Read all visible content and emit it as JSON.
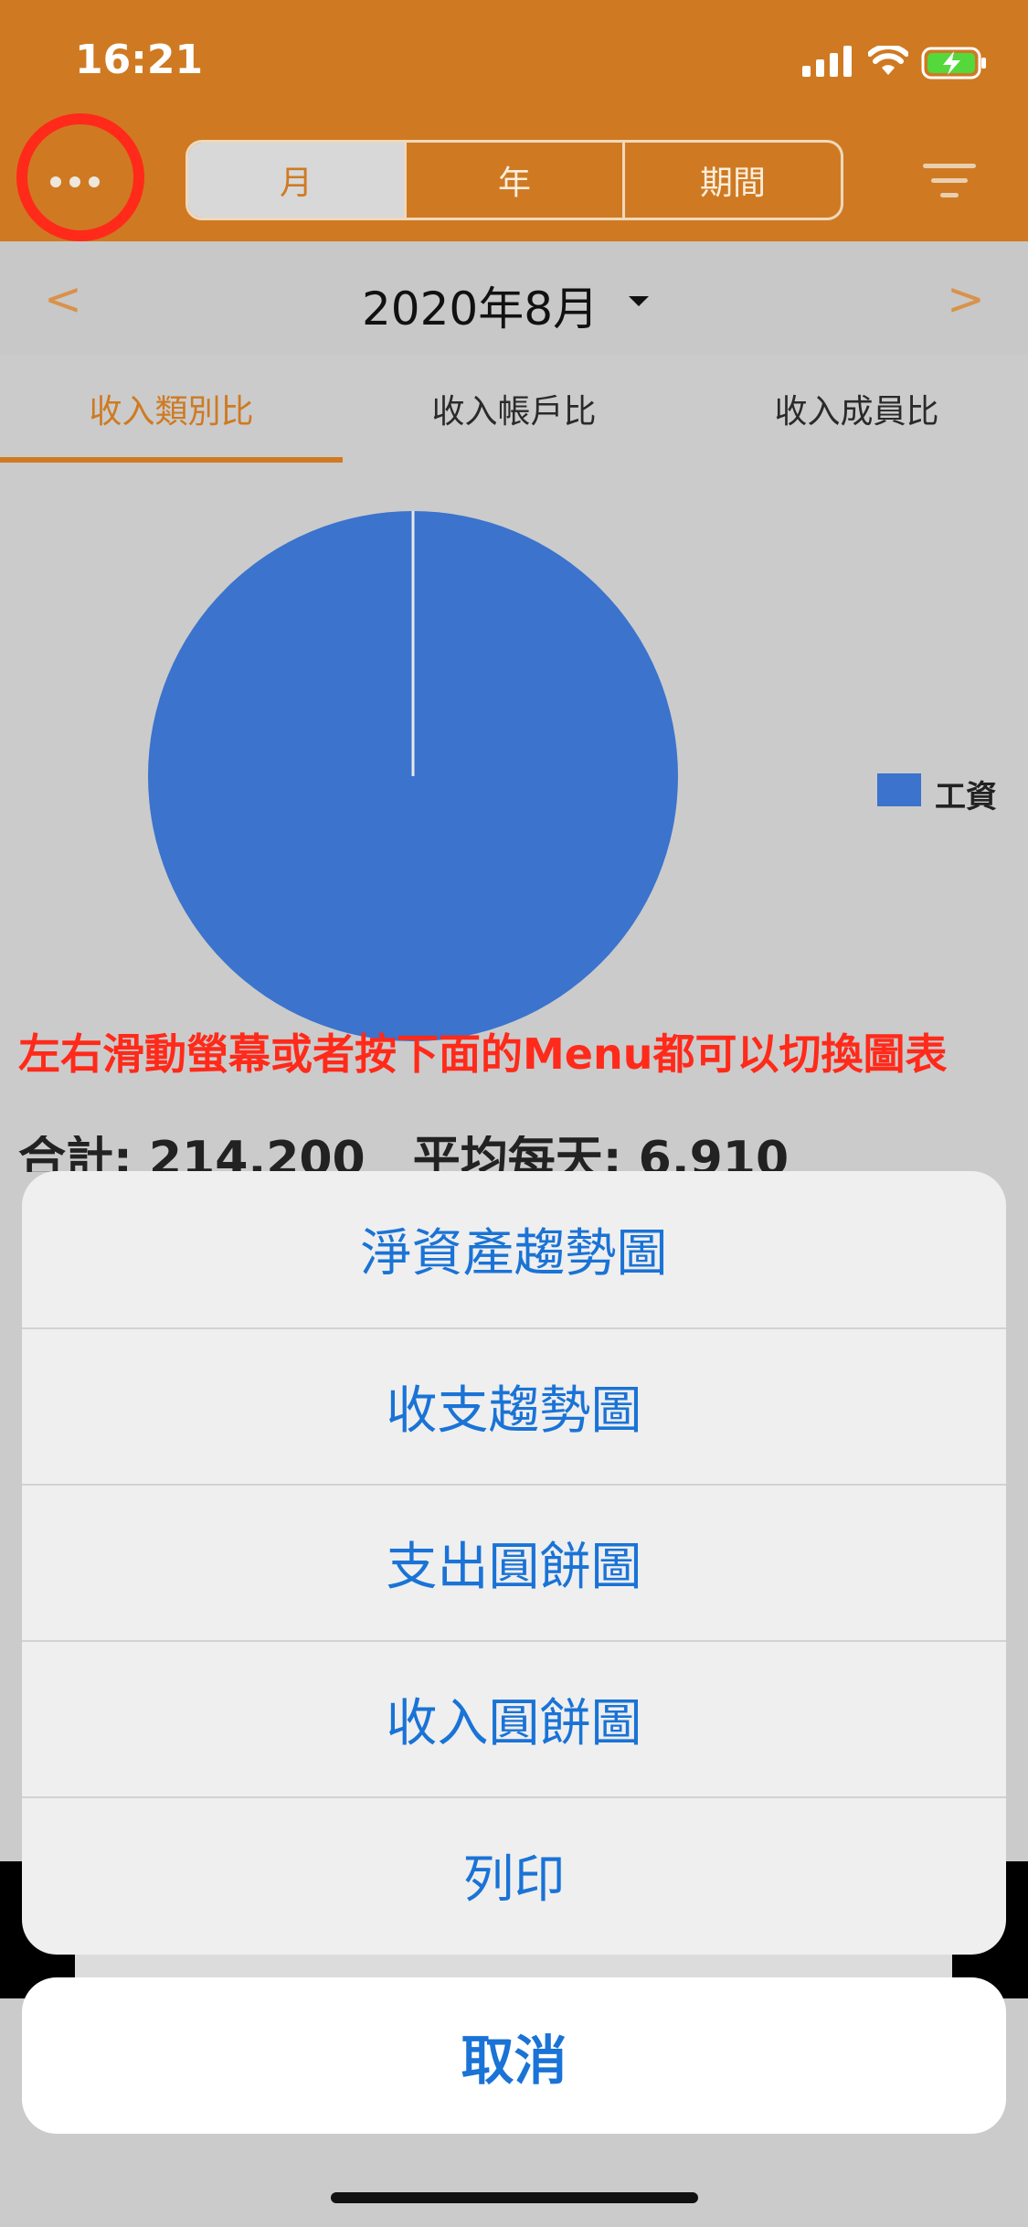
{
  "status_bar": {
    "time": "16:21",
    "icons": [
      "signal-icon",
      "wifi-icon",
      "battery-charging-icon"
    ]
  },
  "nav": {
    "more_icon": "ellipsis-icon",
    "segments": [
      "月",
      "年",
      "期間"
    ],
    "selected_segment": "月",
    "filter_icon": "filter-icon"
  },
  "period": {
    "prev": "<",
    "title": "2020年8月",
    "next": ">"
  },
  "tabs": [
    "收入類別比",
    "收入帳戶比",
    "收入成員比"
  ],
  "chart_data": {
    "type": "pie",
    "categories": [
      "工資"
    ],
    "values": [
      100
    ],
    "colors": [
      "#3b73cd"
    ],
    "legend": "right"
  },
  "hint": "左右滑動螢幕或者按下面的Menu都可以切換圖表",
  "totals_partial": "合計: 214,200　平均每天: 6,910",
  "action_sheet": {
    "items": [
      "淨資產趨勢圖",
      "收支趨勢圖",
      "支出圓餅圖",
      "收入圓餅圖",
      "列印"
    ],
    "cancel": "取消"
  }
}
